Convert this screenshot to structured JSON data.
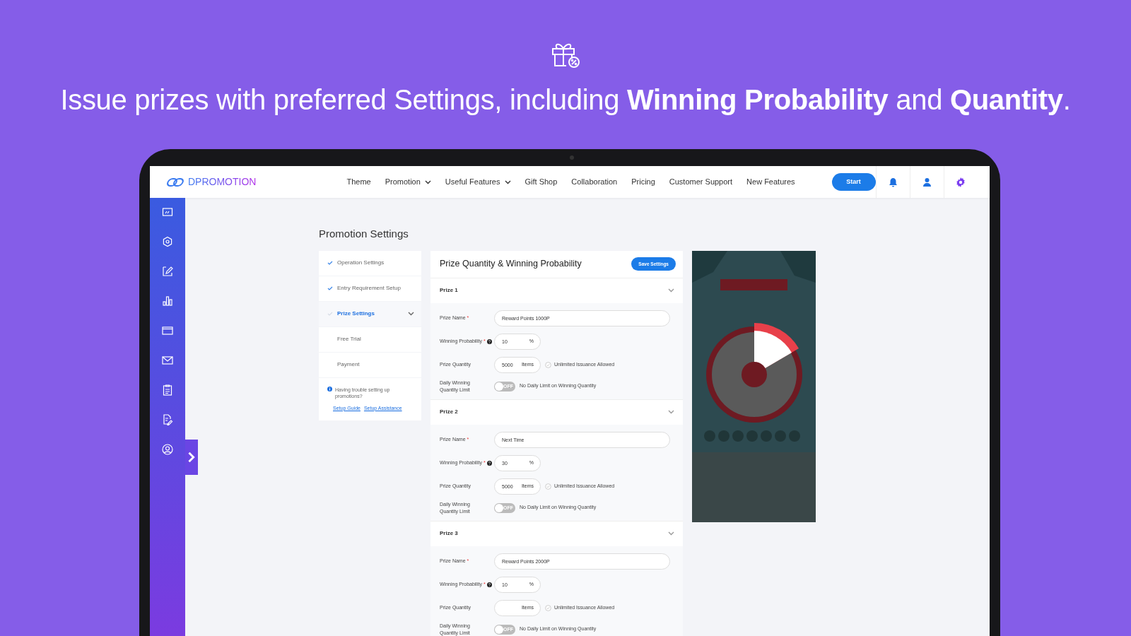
{
  "headline": "Issue prizes with preferred Settings, including **Winning Probability** and **Quantity**.",
  "navbar": {
    "brand": "DPROMOTION",
    "items": [
      {
        "label": "Theme",
        "has_dropdown": false
      },
      {
        "label": "Promotion",
        "has_dropdown": true
      },
      {
        "label": "Useful Features",
        "has_dropdown": true
      },
      {
        "label": "Gift Shop",
        "has_dropdown": false
      },
      {
        "label": "Collaboration",
        "has_dropdown": false
      },
      {
        "label": "Pricing",
        "has_dropdown": false
      },
      {
        "label": "Customer Support",
        "has_dropdown": false
      },
      {
        "label": "New Features",
        "has_dropdown": false
      }
    ],
    "start_button": "Start"
  },
  "page_title": "Promotion Settings",
  "steps": [
    {
      "label": "Operation Settings",
      "done": true,
      "selected": false,
      "has_menu": false
    },
    {
      "label": "Entry Requirement Setup",
      "done": true,
      "selected": false,
      "has_menu": false
    },
    {
      "label": "Prize Settings",
      "done": false,
      "selected": true,
      "has_menu": true
    },
    {
      "label": "Free Trial",
      "done": false,
      "selected": false,
      "has_menu": false
    },
    {
      "label": "Payment",
      "done": false,
      "selected": false,
      "has_menu": false
    }
  ],
  "help": {
    "text": "Having trouble setting up promotions?",
    "links": [
      "Setup Guide",
      "Setup Assistance"
    ]
  },
  "panel": {
    "title": "Prize Quantity & Winning Probability",
    "save_button": "Save Settings",
    "prizes": [
      {
        "title": "Prize 1",
        "expanded": true,
        "name_label": "Prize Name",
        "name_required": "*",
        "name": "Reward Points 1000P",
        "prob_label": "Winning Probability",
        "prob_required": "*",
        "probability": "10",
        "prob_unit": "%",
        "qty_label": "Prize Quantity",
        "quantity": "5000",
        "qty_unit": "Items",
        "unlimited_label": "Unlimited Issuance Allowed",
        "unlimited_checked": false,
        "daily_label": "Daily Winning Quantity Limit",
        "daily_on": false,
        "toggle_text": "OFF",
        "daily_text": "No Daily Limit on Winning Quantity"
      },
      {
        "title": "Prize 2",
        "expanded": true,
        "name_label": "Prize Name",
        "name_required": "*",
        "name": "Next Time",
        "prob_label": "Winning Probability",
        "prob_required": "*",
        "probability": "30",
        "prob_unit": "%",
        "qty_label": "Prize Quantity",
        "quantity": "5000",
        "qty_unit": "Items",
        "unlimited_label": "Unlimited Issuance Allowed",
        "unlimited_checked": false,
        "daily_label": "Daily Winning Quantity Limit",
        "daily_on": false,
        "toggle_text": "OFF",
        "daily_text": "No Daily Limit on Winning Quantity"
      },
      {
        "title": "Prize 3",
        "expanded": true,
        "name_label": "Prize Name",
        "name_required": "*",
        "name": "Reward Points 2000P",
        "prob_label": "Winning Probability",
        "prob_required": "*",
        "probability": "10",
        "prob_unit": "%",
        "qty_label": "Prize Quantity",
        "qty_unit": "Items",
        "unlimited_label": "Unlimited Issuance Allowed",
        "unlimited_checked": false,
        "daily_label": "Daily Winning Quantity Limit",
        "daily_on": false,
        "toggle_text": "OFF",
        "daily_text": "No Daily Limit on Winning Quantity"
      }
    ]
  }
}
